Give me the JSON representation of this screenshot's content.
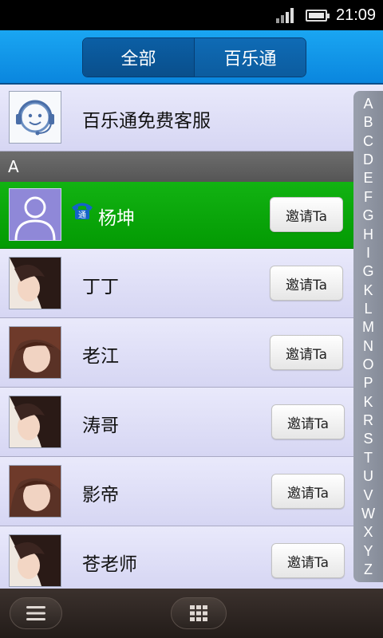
{
  "status_bar": {
    "time": "21:09",
    "icons": [
      "signal-icon",
      "battery-icon"
    ]
  },
  "tabs": [
    {
      "label": "全部",
      "active": true
    },
    {
      "label": "百乐通",
      "active": false
    }
  ],
  "service": {
    "name": "百乐通免费客服",
    "icon": "headset-smiley-icon"
  },
  "section": {
    "letter": "A"
  },
  "contacts": [
    {
      "name": "杨坤",
      "highlighted": true,
      "badge": "通",
      "invite_label": "邀请Ta",
      "avatar": "default-person-avatar"
    },
    {
      "name": "丁丁",
      "highlighted": false,
      "invite_label": "邀请Ta",
      "avatar": "photo-avatar"
    },
    {
      "name": "老江",
      "highlighted": false,
      "invite_label": "邀请Ta",
      "avatar": "photo-avatar"
    },
    {
      "name": "涛哥",
      "highlighted": false,
      "invite_label": "邀请Ta",
      "avatar": "photo-avatar"
    },
    {
      "name": "影帝",
      "highlighted": false,
      "invite_label": "邀请Ta",
      "avatar": "photo-avatar"
    },
    {
      "name": "苍老师",
      "highlighted": false,
      "invite_label": "邀请Ta",
      "avatar": "photo-avatar"
    }
  ],
  "alphabet_index": [
    "A",
    "B",
    "C",
    "D",
    "E",
    "F",
    "G",
    "H",
    "I",
    "G",
    "K",
    "L",
    "M",
    "N",
    "O",
    "P",
    "K",
    "R",
    "S",
    "T",
    "U",
    "V",
    "W",
    "X",
    "Y",
    "Z"
  ],
  "bottom_bar": {
    "left_icon": "menu-icon",
    "center_icon": "grid-icon"
  },
  "colors": {
    "header_blue": "#0a86de",
    "highlight_green": "#039a03",
    "list_bg": "#dcdcf7"
  }
}
